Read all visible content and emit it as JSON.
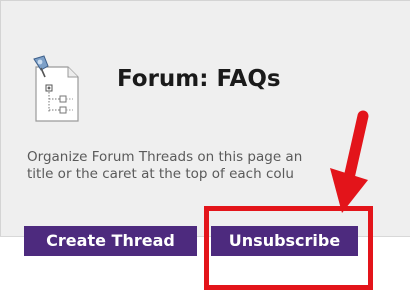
{
  "header": {
    "title": "Forum: FAQs",
    "icon": "forum-document-icon"
  },
  "description": {
    "line1": "Organize Forum Threads on this page an",
    "line2": "title or the caret at the top of each colu"
  },
  "actions": {
    "create_label": "Create Thread",
    "unsubscribe_label": "Unsubscribe"
  },
  "colors": {
    "button_bg": "#4d2a7e",
    "annotation": "#e3141a"
  }
}
